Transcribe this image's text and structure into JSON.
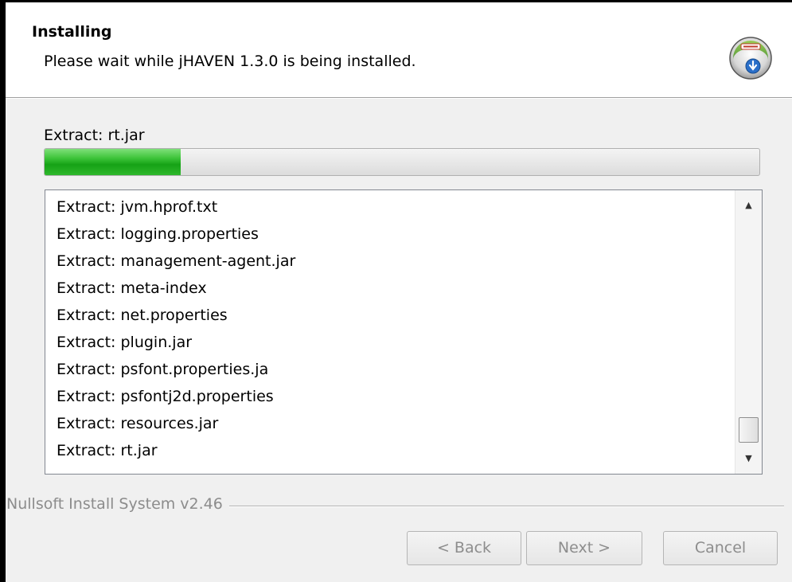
{
  "header": {
    "title": "Installing",
    "subtitle": "Please wait while jHAVEN 1.3.0 is being installed.",
    "logo_icon": "installer-disc-icon"
  },
  "status": {
    "current_text": "Extract: rt.jar",
    "progress_fraction": 0.19
  },
  "log": {
    "items": [
      "Extract: jvm.hprof.txt",
      "Extract: logging.properties",
      "Extract: management-agent.jar",
      "Extract: meta-index",
      "Extract: net.properties",
      "Extract: plugin.jar",
      "Extract: psfont.properties.ja",
      "Extract: psfontj2d.properties",
      "Extract: resources.jar",
      "Extract: rt.jar"
    ],
    "scroll_up_icon": "scroll-up-arrow-icon",
    "scroll_down_icon": "scroll-down-arrow-icon"
  },
  "footer": {
    "branding": "Nullsoft Install System v2.46",
    "back_label": "< Back",
    "next_label": "Next >",
    "cancel_label": "Cancel"
  }
}
